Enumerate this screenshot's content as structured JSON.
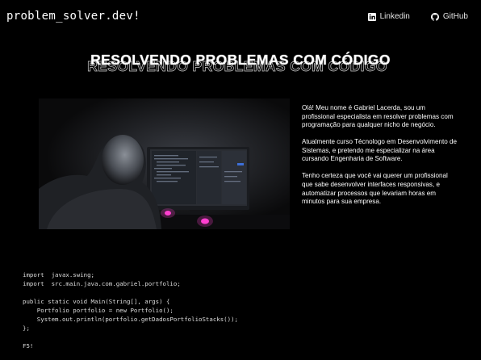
{
  "header": {
    "brand": "problem_solver.dev!",
    "links": [
      {
        "label": "Linkedin",
        "icon": "linkedin-icon"
      },
      {
        "label": "GitHub",
        "icon": "github-icon"
      }
    ]
  },
  "hero": {
    "title": "RESOLVENDO PROBLEMAS COM CÓDIGO"
  },
  "about": {
    "paragraphs": [
      " Olá! Meu nome é Gabriel Lacerda,  sou um profissional especialista em resolver problemas com programação para qualquer nicho de negócio.",
      " Atualmente curso Técnologo em Desenvolvimento de Sistemas, e  pretendo me especializar na área cursando Engenharia de Software.",
      "Tenho certeza que você vai querer um profissional que sabe desenvolver interfaces responsivas, e automatizar processos que levariam horas em minutos para sua empresa."
    ]
  },
  "code": {
    "lines": [
      "import  javax.swing;",
      "import  src.main.java.com.gabriel.portfolio;",
      "",
      "public static void Main(String[], args) {",
      "    Portfolio portfolio = new Portfolio();",
      "    System.out.println(portfolio.getDadosPortfolioStacks());",
      "};",
      "",
      "F5!"
    ]
  },
  "colors": {
    "background": "#000000",
    "text": "#ffffff",
    "monitor_accent": "#ff3fd0"
  }
}
